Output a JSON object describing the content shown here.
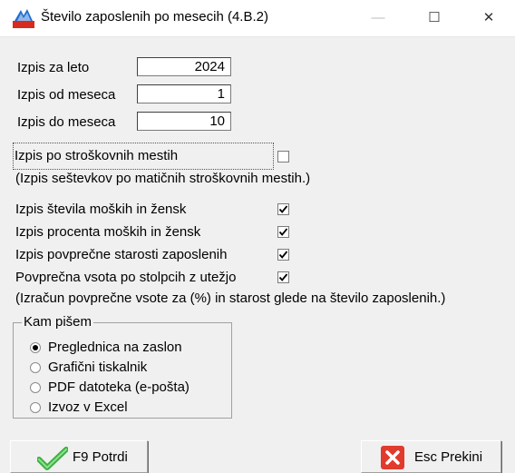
{
  "window": {
    "title": "Število zaposlenih po mesecih  (4.B.2)",
    "minimize_glyph": "—",
    "maximize_glyph": "☐",
    "close_glyph": "✕"
  },
  "fields": [
    {
      "label": "Izpis za leto",
      "value": "2024"
    },
    {
      "label": "Izpis od meseca",
      "value": "1"
    },
    {
      "label": "Izpis do meseca",
      "value": "10"
    }
  ],
  "cost_center": {
    "label": "Izpis po stroškovnih mestih",
    "checked": false,
    "note": "(Izpis seštevkov po matičnih stroškovnih mestih.)"
  },
  "options": [
    {
      "label": "Izpis števila moških in žensk",
      "checked": true
    },
    {
      "label": "Izpis procenta moških in žensk",
      "checked": true
    },
    {
      "label": "Izpis povprečne starosti zaposlenih",
      "checked": true
    },
    {
      "label": "Povprečna vsota po stolpcih z utežjo",
      "checked": true
    }
  ],
  "options_note": "(Izračun povprečne vsote za (%) in starost glede na število zaposlenih.)",
  "output": {
    "legend": "Kam pišem",
    "items": [
      {
        "label": "Preglednica na zaslon",
        "selected": true
      },
      {
        "label": "Grafični tiskalnik",
        "selected": false
      },
      {
        "label": "PDF datoteka (e-pošta)",
        "selected": false
      },
      {
        "label": "Izvoz v Excel",
        "selected": false
      }
    ]
  },
  "buttons": {
    "confirm": "F9 Potrdi",
    "cancel": "Esc Prekini"
  },
  "icons": {
    "app": "app-logo-icon",
    "confirm": "green-check-icon",
    "cancel": "red-x-icon"
  },
  "colors": {
    "check_green": "#3cb043",
    "cancel_red": "#e03b2c"
  }
}
